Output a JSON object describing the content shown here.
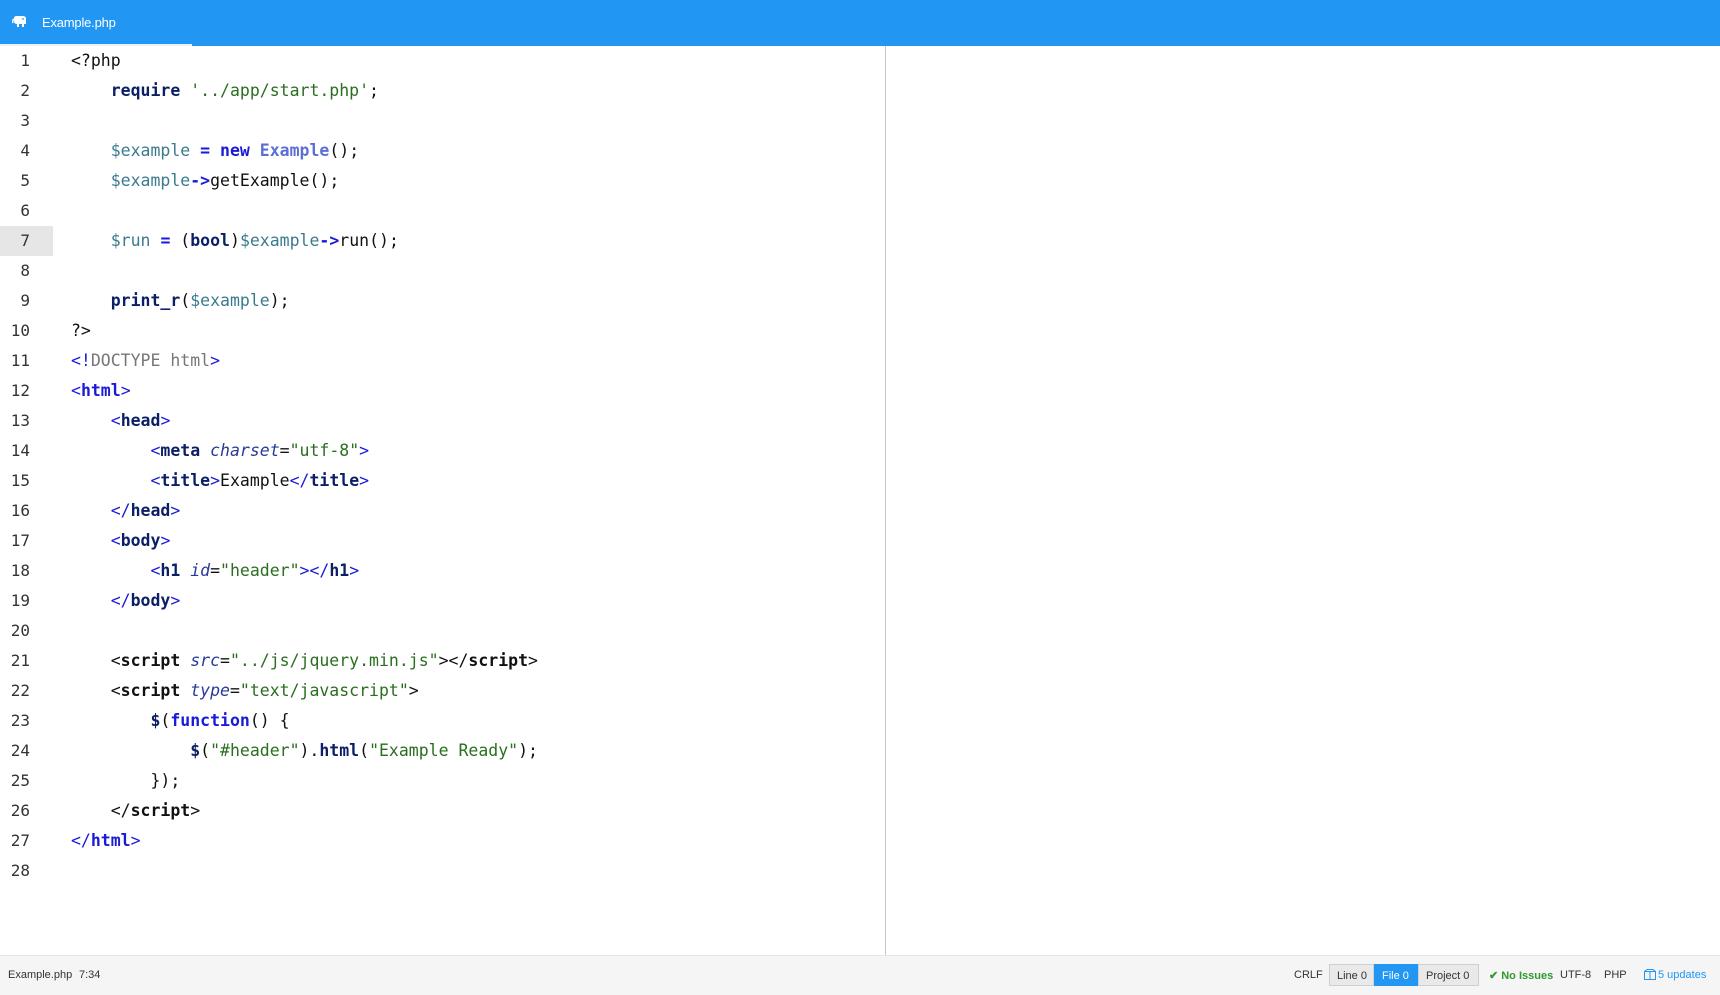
{
  "tab": {
    "title": "Example.php",
    "icon": "php-elephant-icon"
  },
  "editor": {
    "active_line": 7,
    "lines": [
      {
        "n": "1",
        "tokens": [
          [
            "plain",
            "<?php"
          ]
        ]
      },
      {
        "n": "2",
        "tokens": [
          [
            "plain",
            "    "
          ],
          [
            "kw",
            "require"
          ],
          [
            "plain",
            " "
          ],
          [
            "str",
            "'../app/start.php'"
          ],
          [
            "plain",
            ";"
          ]
        ]
      },
      {
        "n": "3",
        "tokens": []
      },
      {
        "n": "4",
        "tokens": [
          [
            "plain",
            "    "
          ],
          [
            "var",
            "$example"
          ],
          [
            "plain",
            " "
          ],
          [
            "op",
            "="
          ],
          [
            "plain",
            " "
          ],
          [
            "kwb",
            "new"
          ],
          [
            "plain",
            " "
          ],
          [
            "cls",
            "Example"
          ],
          [
            "plain",
            "();"
          ]
        ]
      },
      {
        "n": "5",
        "tokens": [
          [
            "plain",
            "    "
          ],
          [
            "var",
            "$example"
          ],
          [
            "op",
            "->"
          ],
          [
            "plain",
            "getExample();"
          ]
        ]
      },
      {
        "n": "6",
        "tokens": []
      },
      {
        "n": "7",
        "tokens": [
          [
            "plain",
            "    "
          ],
          [
            "var",
            "$run"
          ],
          [
            "plain",
            " "
          ],
          [
            "op",
            "="
          ],
          [
            "plain",
            " ("
          ],
          [
            "kw",
            "bool"
          ],
          [
            "plain",
            ")"
          ],
          [
            "var",
            "$example"
          ],
          [
            "op",
            "->"
          ],
          [
            "plain",
            "run();"
          ]
        ]
      },
      {
        "n": "8",
        "tokens": []
      },
      {
        "n": "9",
        "tokens": [
          [
            "plain",
            "    "
          ],
          [
            "kw",
            "print_r"
          ],
          [
            "plain",
            "("
          ],
          [
            "var",
            "$example"
          ],
          [
            "plain",
            ");"
          ]
        ]
      },
      {
        "n": "10",
        "tokens": [
          [
            "plain",
            "?>"
          ]
        ]
      },
      {
        "n": "11",
        "tokens": [
          [
            "tag",
            "<!"
          ],
          [
            "doc",
            "DOCTYPE html"
          ],
          [
            "tag",
            ">"
          ]
        ]
      },
      {
        "n": "12",
        "tokens": [
          [
            "tag",
            "<"
          ],
          [
            "tagb",
            "html"
          ],
          [
            "tag",
            ">"
          ]
        ]
      },
      {
        "n": "13",
        "tokens": [
          [
            "plain",
            "    "
          ],
          [
            "tag",
            "<"
          ],
          [
            "kw",
            "head"
          ],
          [
            "tag",
            ">"
          ]
        ]
      },
      {
        "n": "14",
        "tokens": [
          [
            "plain",
            "        "
          ],
          [
            "tag",
            "<"
          ],
          [
            "kw",
            "meta"
          ],
          [
            "plain",
            " "
          ],
          [
            "attr",
            "charset"
          ],
          [
            "plain",
            "="
          ],
          [
            "str",
            "\"utf-8\""
          ],
          [
            "tag",
            ">"
          ]
        ]
      },
      {
        "n": "15",
        "tokens": [
          [
            "plain",
            "        "
          ],
          [
            "tag",
            "<"
          ],
          [
            "kw",
            "title"
          ],
          [
            "tag",
            ">"
          ],
          [
            "plain",
            "Example"
          ],
          [
            "tag",
            "</"
          ],
          [
            "kw",
            "title"
          ],
          [
            "tag",
            ">"
          ]
        ]
      },
      {
        "n": "16",
        "tokens": [
          [
            "plain",
            "    "
          ],
          [
            "tag",
            "</"
          ],
          [
            "kw",
            "head"
          ],
          [
            "tag",
            ">"
          ]
        ]
      },
      {
        "n": "17",
        "tokens": [
          [
            "plain",
            "    "
          ],
          [
            "tag",
            "<"
          ],
          [
            "kw",
            "body"
          ],
          [
            "tag",
            ">"
          ]
        ]
      },
      {
        "n": "18",
        "tokens": [
          [
            "plain",
            "        "
          ],
          [
            "tag",
            "<"
          ],
          [
            "kw",
            "h1"
          ],
          [
            "plain",
            " "
          ],
          [
            "attr",
            "id"
          ],
          [
            "plain",
            "="
          ],
          [
            "str",
            "\"header\""
          ],
          [
            "tag",
            "></"
          ],
          [
            "kw",
            "h1"
          ],
          [
            "tag",
            ">"
          ]
        ]
      },
      {
        "n": "19",
        "tokens": [
          [
            "plain",
            "    "
          ],
          [
            "tag",
            "</"
          ],
          [
            "kw",
            "body"
          ],
          [
            "tag",
            ">"
          ]
        ]
      },
      {
        "n": "20",
        "tokens": []
      },
      {
        "n": "21",
        "tokens": [
          [
            "plain",
            "    <"
          ],
          [
            "tagk",
            "script"
          ],
          [
            "plain",
            " "
          ],
          [
            "attr",
            "src"
          ],
          [
            "plain",
            "="
          ],
          [
            "str",
            "\"../js/jquery.min.js\""
          ],
          [
            "plain",
            "></"
          ],
          [
            "tagk",
            "script"
          ],
          [
            "plain",
            ">"
          ]
        ]
      },
      {
        "n": "22",
        "tokens": [
          [
            "plain",
            "    <"
          ],
          [
            "tagk",
            "script"
          ],
          [
            "plain",
            " "
          ],
          [
            "attr",
            "type"
          ],
          [
            "plain",
            "="
          ],
          [
            "str",
            "\"text/javascript\""
          ],
          [
            "plain",
            ">"
          ]
        ]
      },
      {
        "n": "23",
        "tokens": [
          [
            "plain",
            "        "
          ],
          [
            "kw",
            "$"
          ],
          [
            "plain",
            "("
          ],
          [
            "kwb",
            "function"
          ],
          [
            "plain",
            "() {"
          ]
        ]
      },
      {
        "n": "24",
        "tokens": [
          [
            "plain",
            "            "
          ],
          [
            "kw",
            "$"
          ],
          [
            "plain",
            "("
          ],
          [
            "str",
            "\"#header\""
          ],
          [
            "plain",
            ")."
          ],
          [
            "kw",
            "html"
          ],
          [
            "plain",
            "("
          ],
          [
            "str",
            "\"Example Ready\""
          ],
          [
            "plain",
            ");"
          ]
        ]
      },
      {
        "n": "25",
        "tokens": [
          [
            "plain",
            "        });"
          ]
        ]
      },
      {
        "n": "26",
        "tokens": [
          [
            "plain",
            "    </"
          ],
          [
            "tagk",
            "script"
          ],
          [
            "plain",
            ">"
          ]
        ]
      },
      {
        "n": "27",
        "tokens": [
          [
            "tag",
            "</"
          ],
          [
            "tagb",
            "html"
          ],
          [
            "tag",
            ">"
          ]
        ]
      },
      {
        "n": "28",
        "tokens": []
      }
    ]
  },
  "status": {
    "file": "Example.php",
    "cursor": "7:34",
    "line_ending": "CRLF",
    "lint_line": "Line 0",
    "lint_file": "File 0",
    "lint_project": "Project 0",
    "issues": "No Issues",
    "encoding": "UTF-8",
    "grammar": "PHP",
    "updates": "5 updates"
  },
  "colors": {
    "accent": "#2196f3",
    "issues_ok": "#2e9a2e"
  }
}
